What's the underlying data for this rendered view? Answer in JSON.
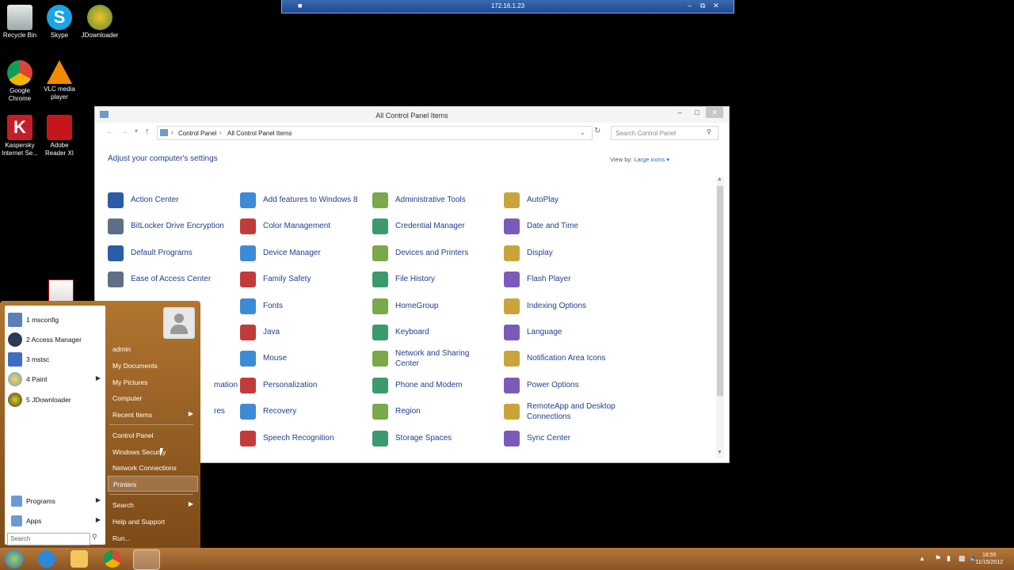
{
  "rdp": {
    "host": "172.16.1.23"
  },
  "desktop_icons": [
    {
      "label": "Recycle Bin",
      "icon": "recycle-bin-icon"
    },
    {
      "label": "Skype",
      "icon": "skype-icon"
    },
    {
      "label": "JDownloader",
      "icon": "jdownloader-icon"
    },
    {
      "label": "Google Chrome",
      "icon": "chrome-icon"
    },
    {
      "label": "VLC media player",
      "icon": "vlc-icon"
    },
    {
      "label": "Kaspersky Internet Se...",
      "icon": "kaspersky-icon"
    },
    {
      "label": "Adobe Reader XI",
      "icon": "adobe-reader-icon"
    }
  ],
  "window": {
    "title": "All Control Panel Items",
    "breadcrumb": [
      "Control Panel",
      "All Control Panel Items"
    ],
    "search_placeholder": "Search Control Panel",
    "heading": "Adjust your computer's settings",
    "view_by_label": "View by:",
    "view_by_value": "Large icons",
    "items": [
      [
        "Action Center",
        "Add features to Windows 8",
        "Administrative Tools",
        "AutoPlay"
      ],
      [
        "BitLocker Drive Encryption",
        "Color Management",
        "Credential Manager",
        "Date and Time"
      ],
      [
        "Default Programs",
        "Device Manager",
        "Devices and Printers",
        "Display"
      ],
      [
        "Ease of Access Center",
        "Family Safety",
        "File History",
        "Flash Player"
      ],
      [
        "",
        "Fonts",
        "HomeGroup",
        "Indexing Options"
      ],
      [
        "",
        "Java",
        "Keyboard",
        "Language"
      ],
      [
        "",
        "Mouse",
        "Network and Sharing Center",
        "Notification Area Icons"
      ],
      [
        "mation",
        "Personalization",
        "Phone and Modem",
        "Power Options"
      ],
      [
        "res",
        "Recovery",
        "Region",
        "RemoteApp and Desktop Connections"
      ],
      [
        "",
        "Speech Recognition",
        "Storage Spaces",
        "Sync Center"
      ]
    ]
  },
  "start_menu": {
    "recent": [
      "1 msconfig",
      "2 Access Manager",
      "3 mstsc",
      "4 Paint",
      "5 JDownloader"
    ],
    "programs_label": "Programs",
    "apps_label": "Apps",
    "search_placeholder": "Search",
    "right": {
      "user": "admin",
      "my_documents": "My Documents",
      "my_pictures": "My Pictures",
      "computer": "Computer",
      "recent_items": "Recent Items",
      "control_panel": "Control Panel",
      "windows_security": "Windows Security",
      "network_connections": "Network Connections",
      "printers": "Printers",
      "search": "Search",
      "help": "Help and Support",
      "run": "Run..."
    }
  },
  "taskbar": {
    "time": "18:55",
    "date": "11/15/2012"
  }
}
